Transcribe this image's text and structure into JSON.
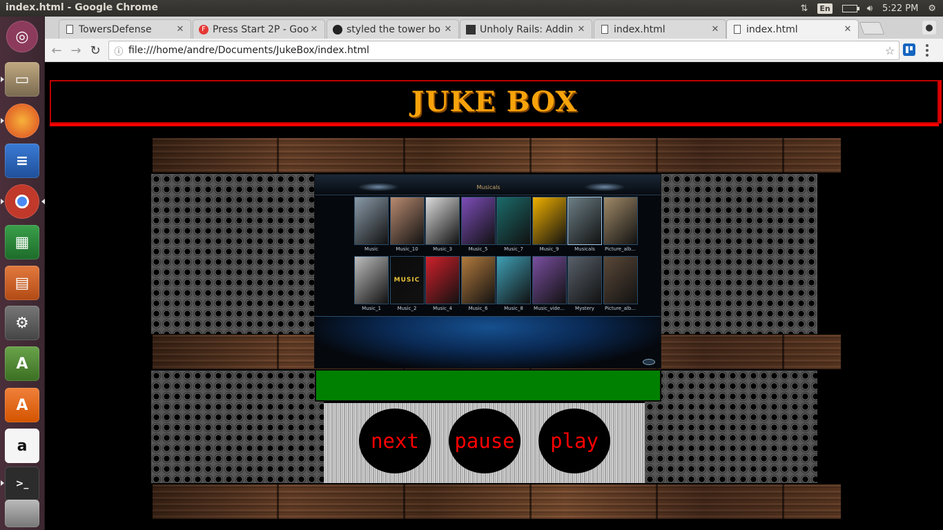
{
  "os": {
    "window_title": "index.html - Google Chrome",
    "keyboard_lang": "En",
    "clock": "5:22 PM"
  },
  "launcher": {
    "items": [
      "Ubuntu",
      "Files",
      "Firefox",
      "Writer",
      "Chrome",
      "Calc",
      "Impress",
      "Settings",
      "Software Updater",
      "Ubuntu Software",
      "Amazon",
      "Terminal",
      "Trash"
    ]
  },
  "browser": {
    "tabs": [
      {
        "label": "TowersDefense",
        "icon": "document-icon"
      },
      {
        "label": "Press Start 2P - Goo",
        "icon": "fonts-icon"
      },
      {
        "label": "styled the tower bo",
        "icon": "github-icon"
      },
      {
        "label": "Unholy Rails: Addin",
        "icon": "site-icon"
      },
      {
        "label": "index.html",
        "icon": "document-icon"
      },
      {
        "label": "index.html",
        "icon": "document-icon"
      }
    ],
    "url": "file:///home/andre/Documents/JukeBox/index.html"
  },
  "page": {
    "title": "JUKE BOX",
    "player": {
      "heading": "Musicals",
      "albums": [
        {
          "caption": "Music",
          "color": "#8a9aa8"
        },
        {
          "caption": "Music_10",
          "color": "#b88a70"
        },
        {
          "caption": "Music_3",
          "color": "#dcdcdc"
        },
        {
          "caption": "Music_5",
          "color": "#7c4db8"
        },
        {
          "caption": "Music_7",
          "color": "#1b6b6a"
        },
        {
          "caption": "Music_9",
          "color": "#f0b000"
        },
        {
          "caption": "Musicals",
          "color": "#6d7f86"
        },
        {
          "caption": "Picture_alb...",
          "color": "#a08a68"
        },
        {
          "caption": "Music_1",
          "color": "#bdbdbd"
        },
        {
          "caption": "Music_2",
          "color": "#0b0b0b"
        },
        {
          "caption": "Music_4",
          "color": "#d0202a"
        },
        {
          "caption": "Music_6",
          "color": "#b27a3d"
        },
        {
          "caption": "Music_8",
          "color": "#3f9fb5"
        },
        {
          "caption": "Music_vide...",
          "color": "#7a4fa0"
        },
        {
          "caption": "Mystery",
          "color": "#58606a"
        },
        {
          "caption": "Picture_alb...",
          "color": "#5a4838"
        }
      ],
      "music_tile_text": "MUSIC"
    },
    "controls": {
      "next": "next",
      "pause": "pause",
      "play": "play"
    }
  }
}
